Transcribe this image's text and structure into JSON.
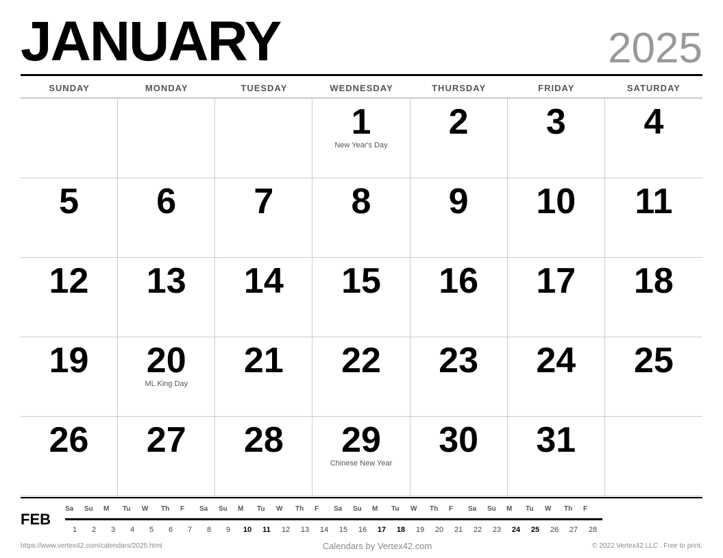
{
  "header": {
    "month": "JANUARY",
    "year": "2025"
  },
  "day_headers": [
    "SUNDAY",
    "MONDAY",
    "TUESDAY",
    "WEDNESDAY",
    "THURSDAY",
    "FRIDAY",
    "SATURDAY"
  ],
  "weeks": [
    [
      {
        "day": "",
        "holiday": ""
      },
      {
        "day": "",
        "holiday": ""
      },
      {
        "day": "",
        "holiday": ""
      },
      {
        "day": "1",
        "holiday": "New Year's Day"
      },
      {
        "day": "2",
        "holiday": ""
      },
      {
        "day": "3",
        "holiday": ""
      },
      {
        "day": "4",
        "holiday": ""
      }
    ],
    [
      {
        "day": "5",
        "holiday": ""
      },
      {
        "day": "6",
        "holiday": ""
      },
      {
        "day": "7",
        "holiday": ""
      },
      {
        "day": "8",
        "holiday": ""
      },
      {
        "day": "9",
        "holiday": ""
      },
      {
        "day": "10",
        "holiday": ""
      },
      {
        "day": "11",
        "holiday": ""
      }
    ],
    [
      {
        "day": "12",
        "holiday": ""
      },
      {
        "day": "13",
        "holiday": ""
      },
      {
        "day": "14",
        "holiday": ""
      },
      {
        "day": "15",
        "holiday": ""
      },
      {
        "day": "16",
        "holiday": ""
      },
      {
        "day": "17",
        "holiday": ""
      },
      {
        "day": "18",
        "holiday": ""
      }
    ],
    [
      {
        "day": "19",
        "holiday": ""
      },
      {
        "day": "20",
        "holiday": "ML King Day"
      },
      {
        "day": "21",
        "holiday": ""
      },
      {
        "day": "22",
        "holiday": ""
      },
      {
        "day": "23",
        "holiday": ""
      },
      {
        "day": "24",
        "holiday": ""
      },
      {
        "day": "25",
        "holiday": ""
      }
    ],
    [
      {
        "day": "26",
        "holiday": ""
      },
      {
        "day": "27",
        "holiday": ""
      },
      {
        "day": "28",
        "holiday": ""
      },
      {
        "day": "29",
        "holiday": "Chinese New Year"
      },
      {
        "day": "30",
        "holiday": ""
      },
      {
        "day": "31",
        "holiday": ""
      },
      {
        "day": "",
        "holiday": ""
      }
    ]
  ],
  "mini_calendar": {
    "label": "FEB",
    "headers": [
      "Sa",
      "Su",
      "M",
      "Tu",
      "W",
      "Th",
      "F",
      "Sa",
      "Su",
      "M",
      "Tu",
      "W",
      "Th",
      "F",
      "Sa",
      "Su",
      "M",
      "Tu",
      "W",
      "Th",
      "F",
      "Sa",
      "Su",
      "M",
      "Tu",
      "W",
      "Th",
      "F"
    ],
    "days": [
      "1",
      "2",
      "3",
      "4",
      "5",
      "6",
      "7",
      "8",
      "9",
      "10",
      "11",
      "12",
      "13",
      "14",
      "15",
      "16",
      "17",
      "18",
      "19",
      "20",
      "21",
      "22",
      "23",
      "24",
      "25",
      "26",
      "27",
      "28"
    ],
    "bold_days": [
      "10",
      "11",
      "17",
      "18",
      "24",
      "25"
    ]
  },
  "footer": {
    "url": "https://www.vertex42.com/calendars/2025.html",
    "center": "Calendars by Vertex42.com",
    "copyright": "© 2022 Vertex42 LLC . Free to print."
  }
}
